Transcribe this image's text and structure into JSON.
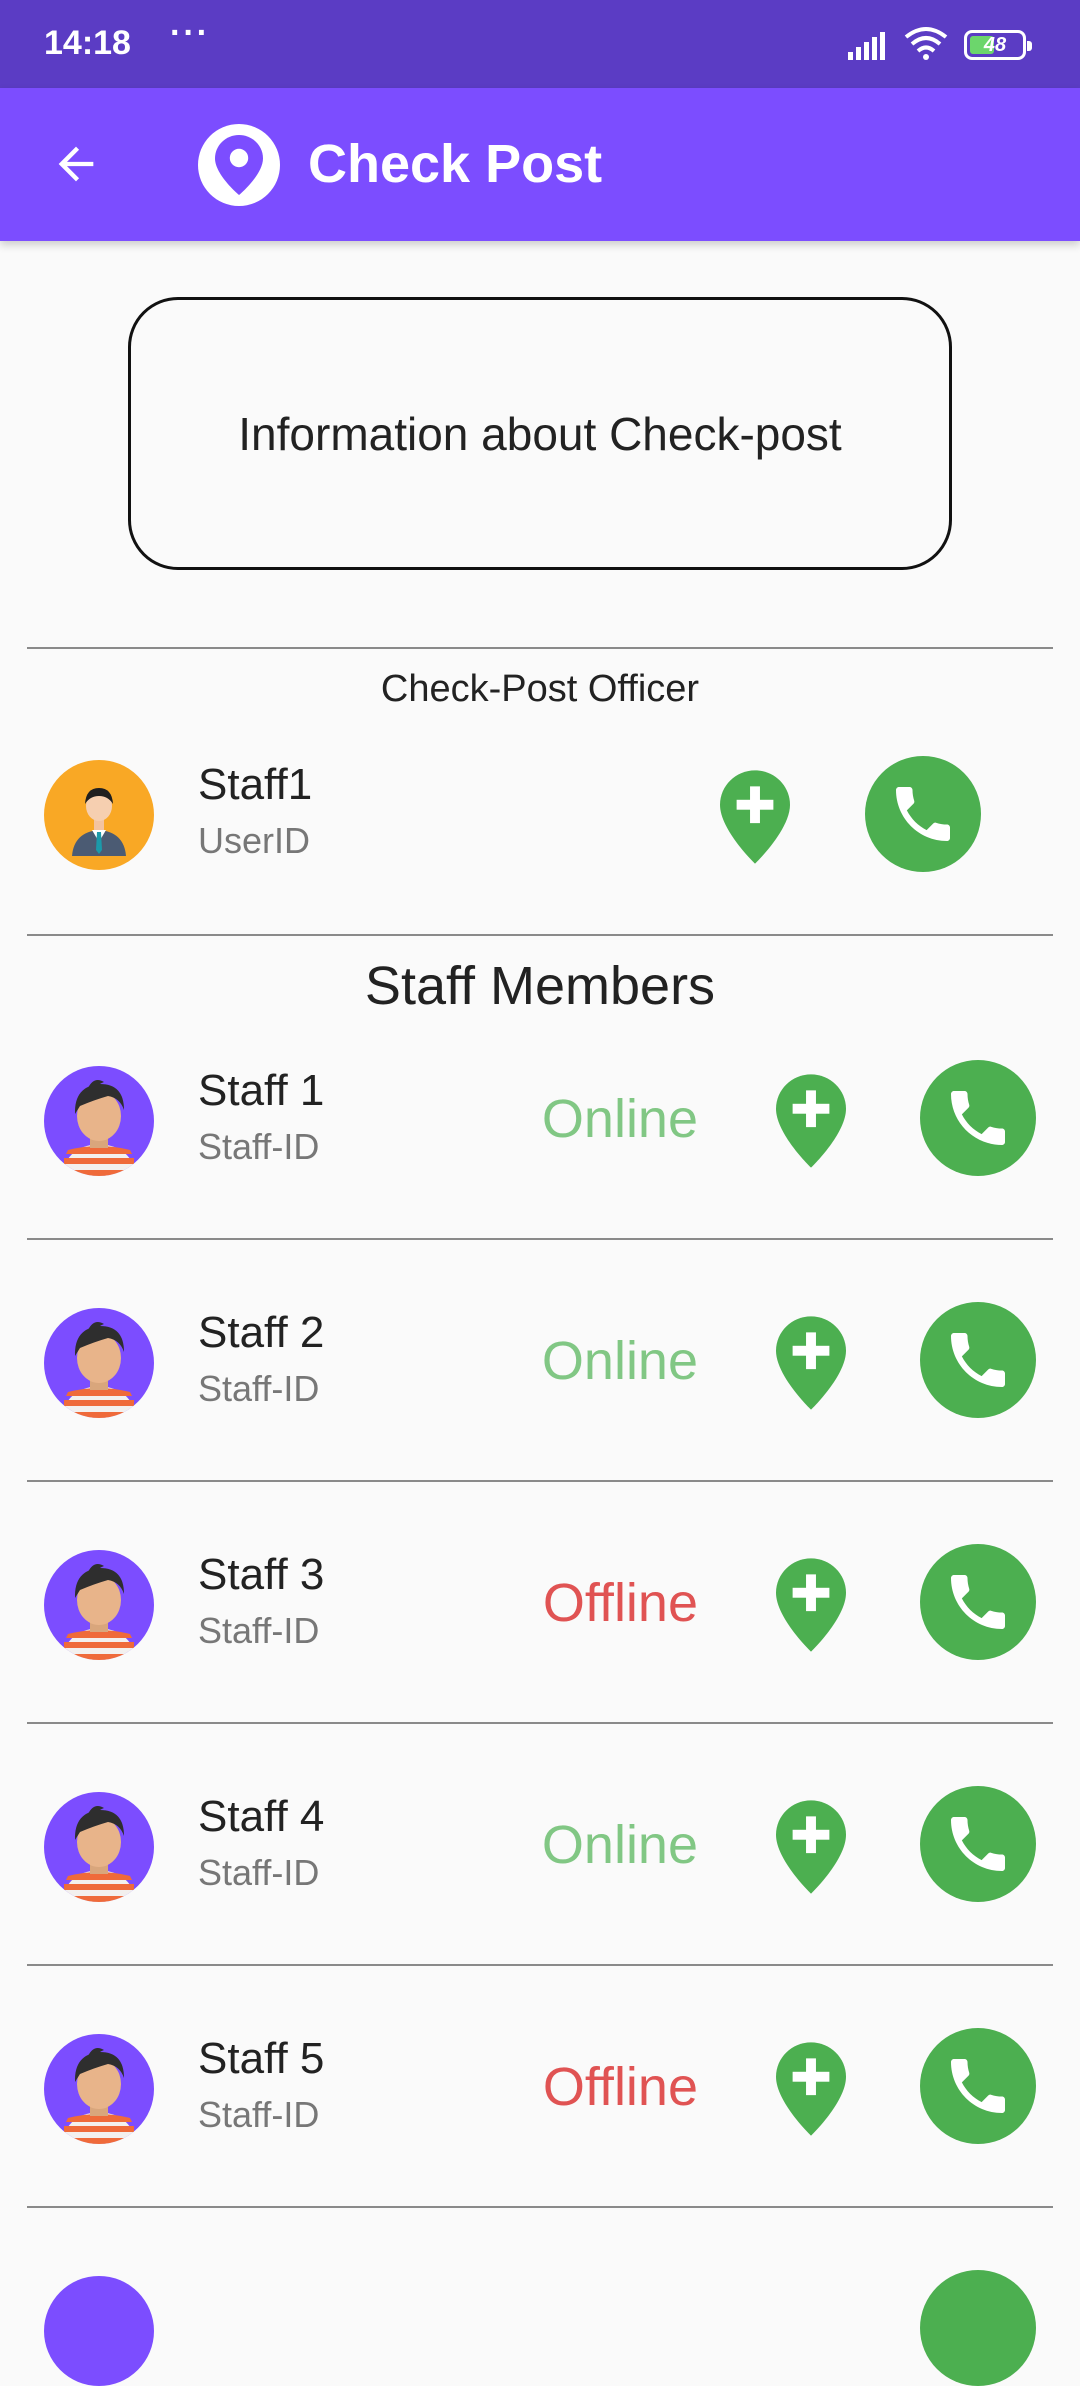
{
  "status_bar": {
    "time": "14:18",
    "dots": "···",
    "battery": "48"
  },
  "app_bar": {
    "title": "Check Post",
    "color": "#7c4dff",
    "status_color": "#5b3cc4"
  },
  "info_card": {
    "text": "Information about Check-post"
  },
  "officer": {
    "section_label": "Check-Post Officer",
    "name": "Staff1",
    "id": "UserID"
  },
  "staff": {
    "section_label": "Staff Members",
    "members": [
      {
        "name": "Staff 1",
        "id": "Staff-ID",
        "status": "Online"
      },
      {
        "name": "Staff 2",
        "id": "Staff-ID",
        "status": "Online"
      },
      {
        "name": "Staff 3",
        "id": "Staff-ID",
        "status": "Offline"
      },
      {
        "name": "Staff 4",
        "id": "Staff-ID",
        "status": "Online"
      },
      {
        "name": "Staff 5",
        "id": "Staff-ID",
        "status": "Offline"
      }
    ]
  },
  "colors": {
    "online": "#81c784",
    "offline": "#e05353",
    "action_green": "#4caf50"
  },
  "icons": {
    "back": "arrow-left-icon",
    "title": "location-pin-icon",
    "add_location": "add-location-icon",
    "call": "phone-icon"
  }
}
